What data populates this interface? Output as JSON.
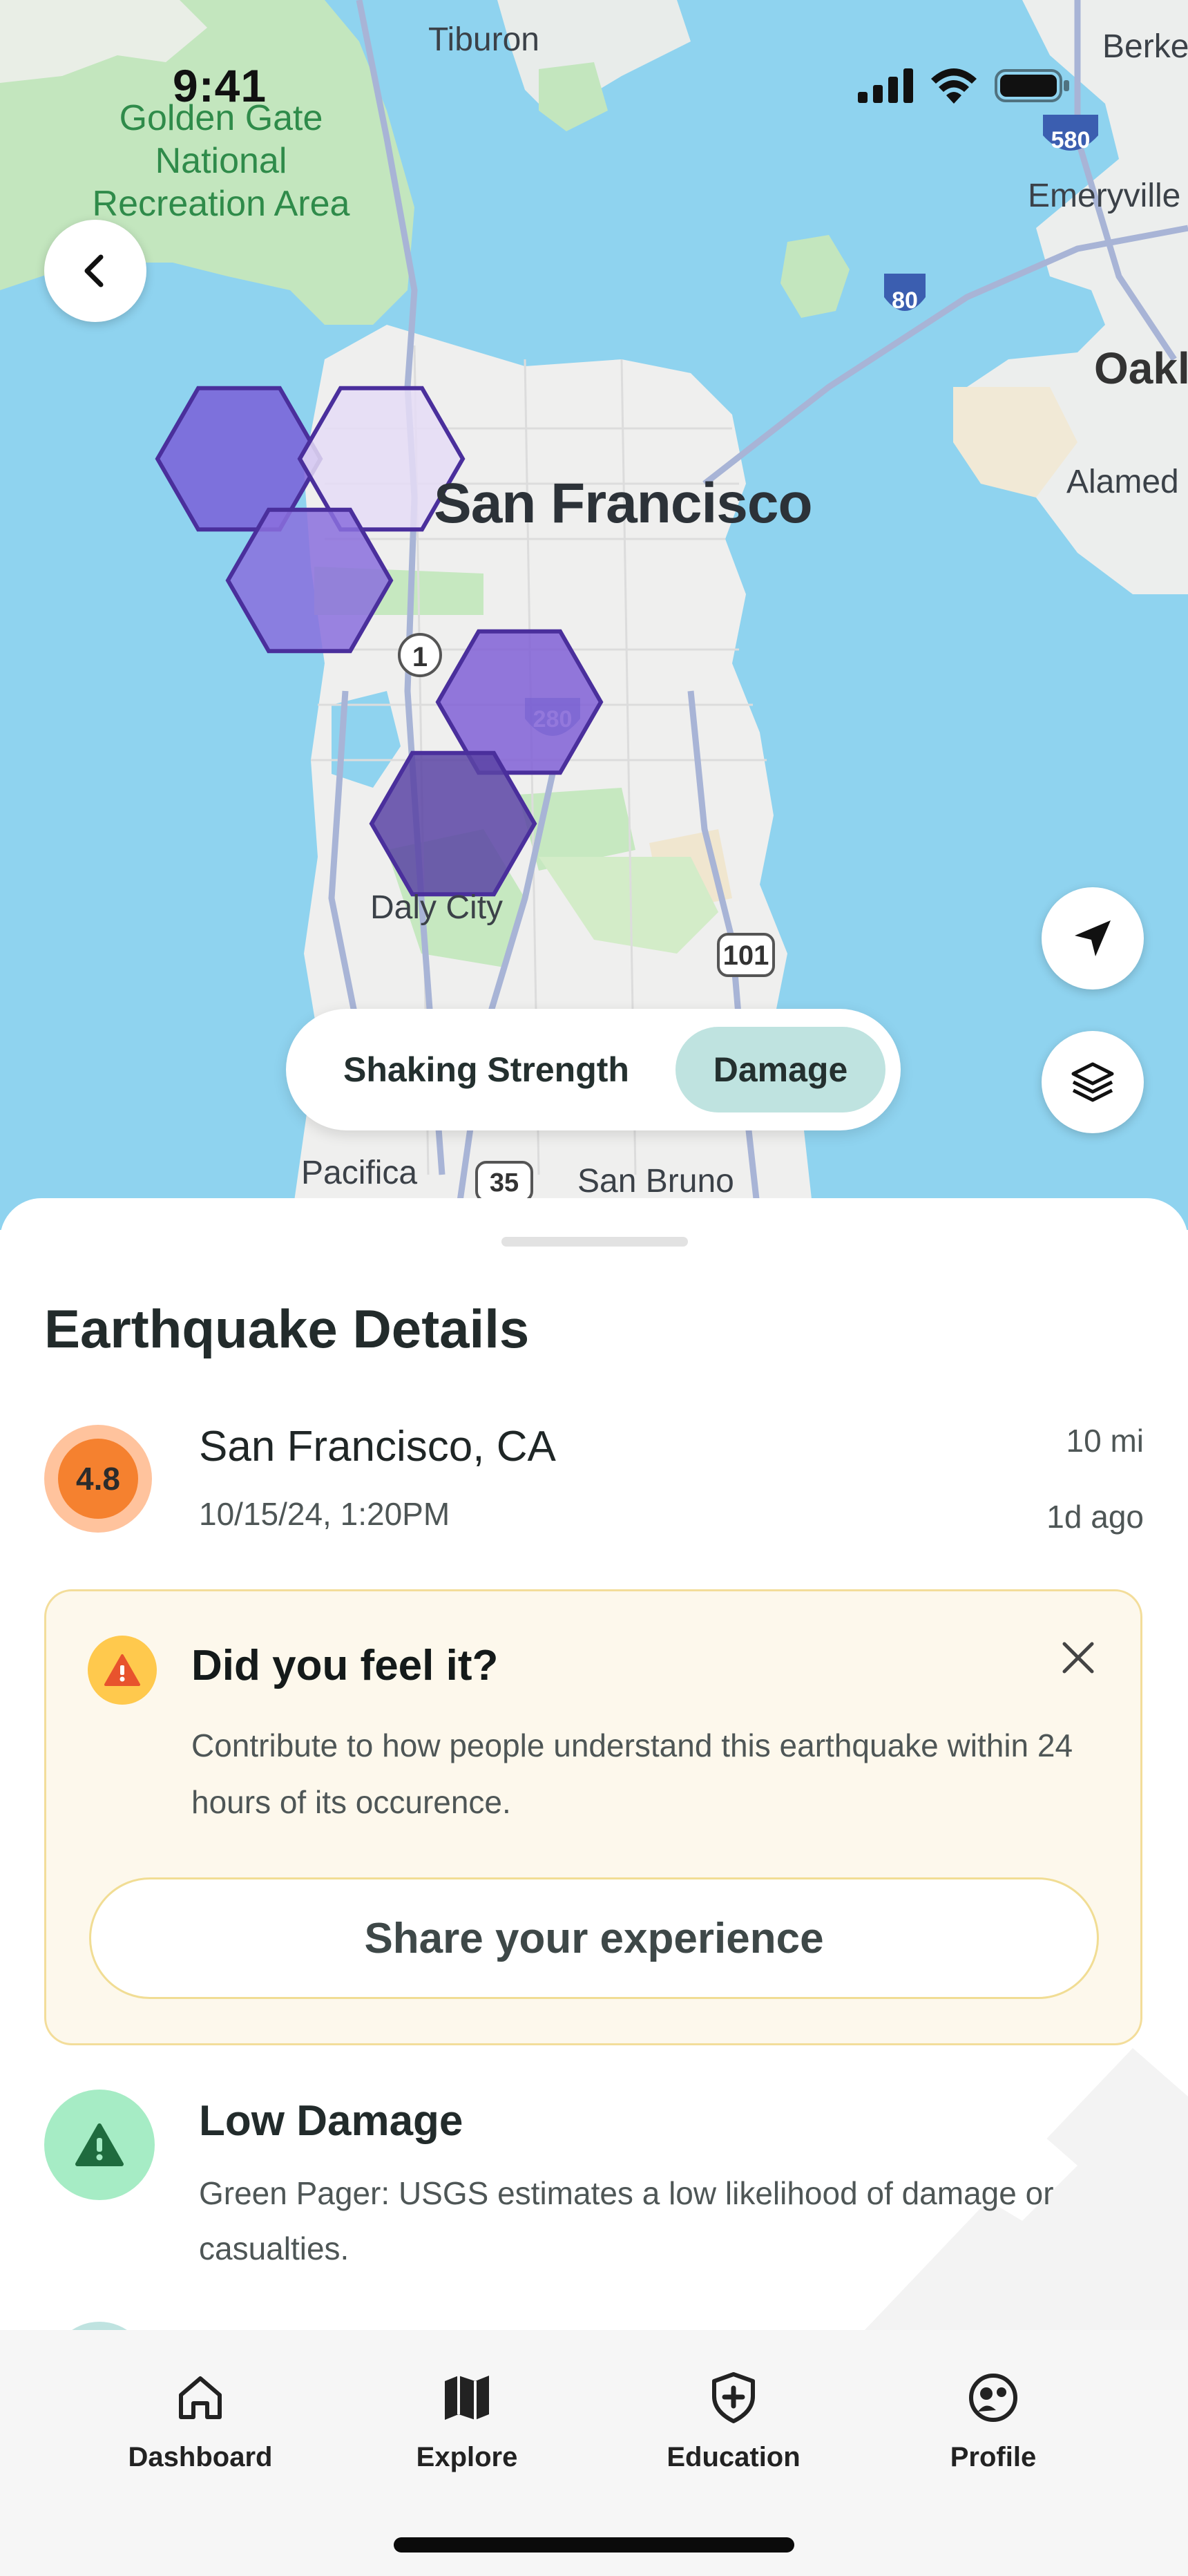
{
  "status_bar": {
    "time": "9:41"
  },
  "map": {
    "labels": {
      "city_main": "San Francisco",
      "tiburon": "Tiburon",
      "park": "Golden Gate National Recreation Area",
      "berkeley": "Berke",
      "emeryville": "Emeryville",
      "oakland": "Oakl",
      "alameda": "Alamed",
      "daly_city": "Daly City",
      "pacifica": "Pacifica",
      "san_bruno": "San Bruno",
      "route_1": "1",
      "route_280": "280",
      "route_101": "101",
      "route_35": "35",
      "route_80": "80",
      "route_580": "580"
    },
    "layer_toggle": {
      "option_left": "Shaking Strength",
      "option_right": "Damage",
      "selected": "Damage"
    },
    "hex_colors": [
      "#7a5fd8",
      "#e5dcf6",
      "#8a6fdd",
      "#8060d6",
      "#5b44a4"
    ]
  },
  "sheet": {
    "title": "Earthquake Details",
    "quake": {
      "magnitude": "4.8",
      "location": "San Francisco, CA",
      "datetime": "10/15/24, 1:20PM",
      "distance": "10 mi",
      "age": "1d ago"
    },
    "feel_card": {
      "heading": "Did you feel it?",
      "body": "Contribute to how people understand this earthquake within 24 hours of its occurence.",
      "button": "Share your experience"
    },
    "damage": {
      "heading": "Low Damage",
      "body": "Green Pager: USGS estimates a low likelihood of damage or casualties."
    }
  },
  "tabbar": {
    "items": [
      {
        "label": "Dashboard",
        "icon": "home-icon"
      },
      {
        "label": "Explore",
        "icon": "map-icon"
      },
      {
        "label": "Education",
        "icon": "shield-plus-icon"
      },
      {
        "label": "Profile",
        "icon": "profile-icon"
      }
    ]
  }
}
